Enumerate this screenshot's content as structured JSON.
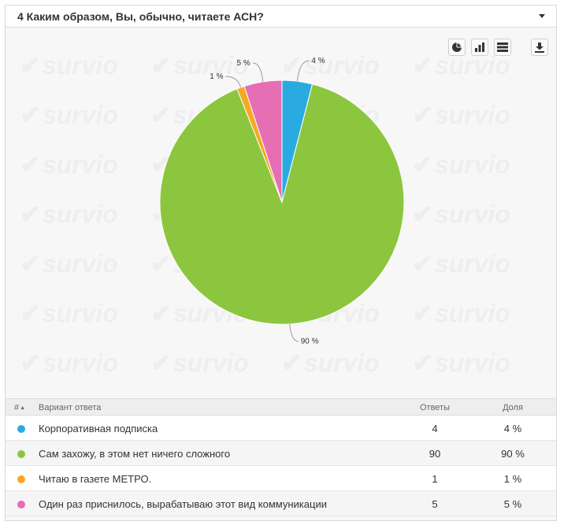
{
  "question": {
    "title": "4 Каким образом, Вы, обычно, читаете АСН?"
  },
  "watermark": {
    "text": "survio"
  },
  "toolbar": {
    "icons": [
      "pie-chart-icon",
      "bar-chart-icon",
      "table-view-icon",
      "download-icon"
    ]
  },
  "colors": {
    "blue": "#29abe2",
    "green": "#8cc63f",
    "orange": "#f7a823",
    "pink": "#e66eb4"
  },
  "chart_data": {
    "type": "pie",
    "categories": [
      "Корпоративная подписка",
      "Сам захожу, в этом нет ничего сложного",
      "Читаю в газете МЕТРО.",
      "Один раз приснилось, вырабатываю этот вид коммуникации"
    ],
    "values": [
      4,
      90,
      1,
      5
    ],
    "labels": [
      "4 %",
      "90 %",
      "1 %",
      "5 %"
    ],
    "colors": [
      "#29abe2",
      "#8cc63f",
      "#f7a823",
      "#e66eb4"
    ]
  },
  "table": {
    "headers": {
      "num": "#",
      "answer": "Вариант ответа",
      "count": "Ответы",
      "share": "Доля"
    },
    "rows": [
      {
        "label": "Корпоративная подписка",
        "count": "4",
        "share": "4 %"
      },
      {
        "label": "Сам захожу, в этом нет ничего сложного",
        "count": "90",
        "share": "90 %"
      },
      {
        "label": "Читаю в газете МЕТРО.",
        "count": "1",
        "share": "1 %"
      },
      {
        "label": "Один раз приснилось, вырабатываю этот вид коммуникации",
        "count": "5",
        "share": "5 %"
      }
    ]
  }
}
